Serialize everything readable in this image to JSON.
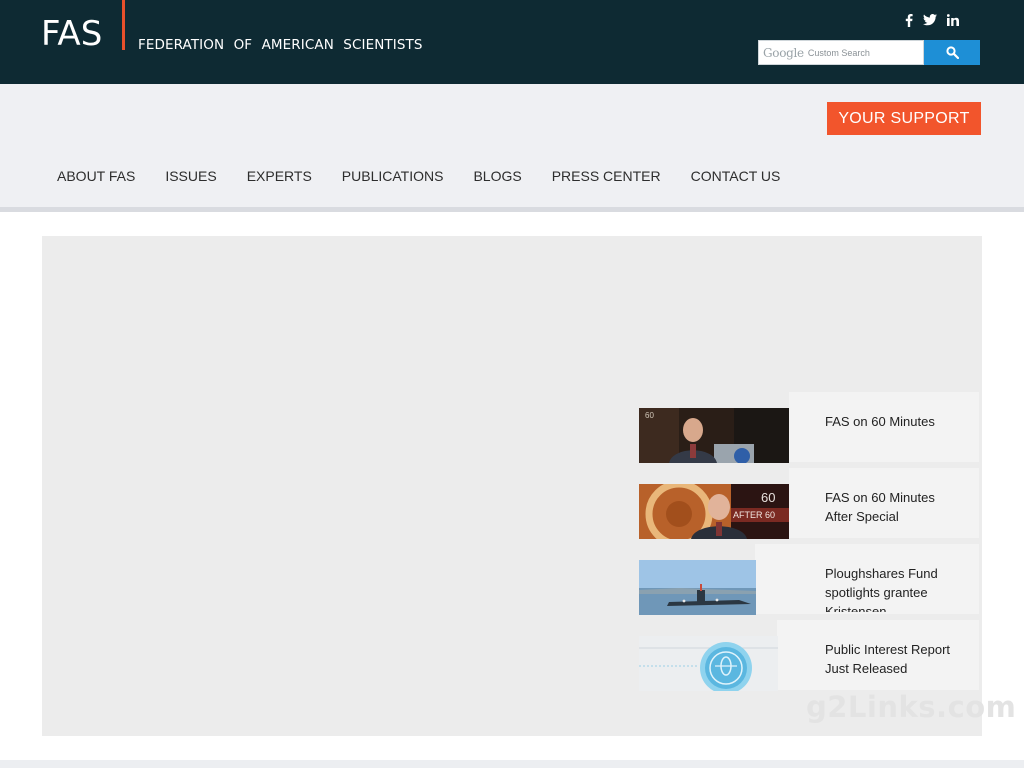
{
  "header": {
    "logo": "FAS",
    "tagline": "FEDERATION OF AMERICAN SCIENTISTS",
    "social": [
      {
        "name": "facebook",
        "icon": "facebook-icon"
      },
      {
        "name": "twitter",
        "icon": "twitter-icon"
      },
      {
        "name": "linkedin",
        "icon": "linkedin-icon"
      }
    ],
    "search": {
      "brand": "Google",
      "placeholder": "Custom Search",
      "button_icon": "search-icon"
    }
  },
  "support_button": "YOUR SUPPORT",
  "nav": [
    "ABOUT FAS",
    "ISSUES",
    "EXPERTS",
    "PUBLICATIONS",
    "BLOGS",
    "PRESS CENTER",
    "CONTACT US"
  ],
  "stories": [
    {
      "title": "FAS on 60 Minutes",
      "thumb": "man-in-studio-thumbnail"
    },
    {
      "title": "FAS on 60 Minutes After Special",
      "thumb": "60-minutes-after-special-thumbnail"
    },
    {
      "title": "Ploughshares Fund spotlights grantee Kristensen",
      "thumb": "submarine-thumbnail"
    },
    {
      "title": "Public Interest Report Just Released",
      "thumb": "report-seal-thumbnail"
    }
  ],
  "watermark": "g2Links.com",
  "colors": {
    "header_bg": "#0e2a33",
    "accent_red": "#e8502b",
    "support_orange": "#f2552c",
    "search_blue": "#1e8fd6",
    "nav_bg": "#eff0f3"
  }
}
